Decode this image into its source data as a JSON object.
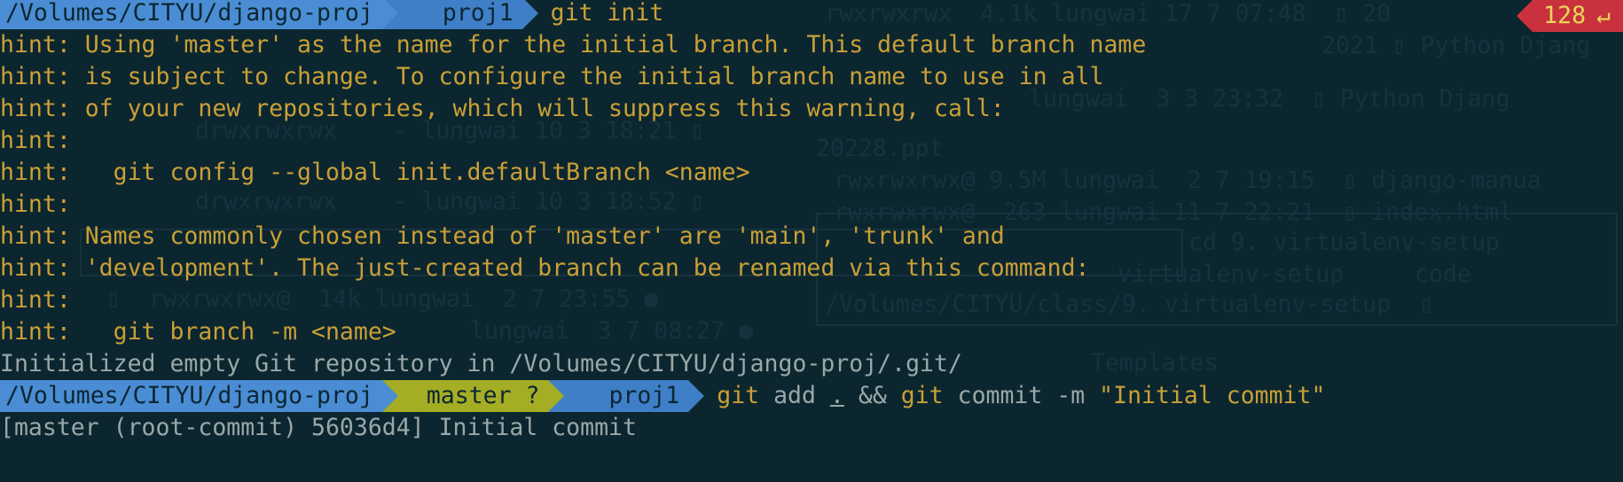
{
  "colors": {
    "background": "#0c2630",
    "hint_text": "#c9a036",
    "output_text": "#9aa8a6",
    "path_segment": "#4a8dd4",
    "git_segment": "#a5ad25",
    "venv_segment": "#3f7fc7",
    "error_badge": "#c9323d",
    "error_badge_text": "#e8d65a"
  },
  "prompt1": {
    "path": "/Volumes/CITYU/django-proj",
    "venv_icon": "python-icon",
    "venv": "proj1",
    "command": "git init"
  },
  "status": {
    "exit_code": "128",
    "return_icon": "↵"
  },
  "hints": [
    "hint: Using 'master' as the name for the initial branch. This default branch name",
    "hint: is subject to change. To configure the initial branch name to use in all",
    "hint: of your new repositories, which will suppress this warning, call:",
    "hint:",
    "hint:   git config --global init.defaultBranch <name>",
    "hint:",
    "hint: Names commonly chosen instead of 'master' are 'main', 'trunk' and",
    "hint: 'development'. The just-created branch can be renamed via this command:",
    "hint:",
    "hint:   git branch -m <name>"
  ],
  "output": "Initialized empty Git repository in /Volumes/CITYU/django-proj/.git/",
  "prompt2": {
    "path": "/Volumes/CITYU/django-proj",
    "branch_icon": "git-branch-icon",
    "branch": "master ?",
    "venv_icon": "python-icon",
    "venv": "proj1",
    "command_git1": "git",
    "command_add": "add",
    "command_dot": ".",
    "command_and": "&&",
    "command_git2": "git",
    "command_commit": "commit -m",
    "command_msg": "\"Initial commit\""
  },
  "partial_line": "[master (root-commit) 56036d4] Initial commit"
}
